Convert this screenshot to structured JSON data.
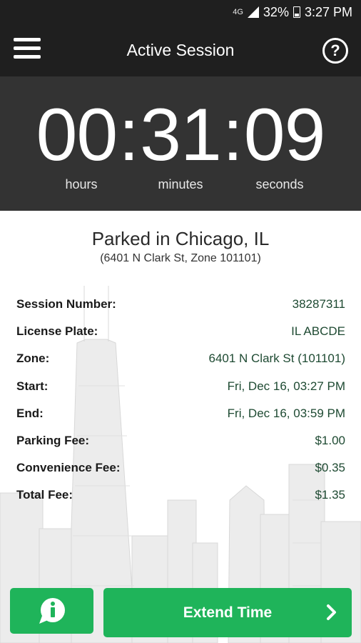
{
  "status_bar": {
    "network": "4G",
    "battery": "32%",
    "time": "3:27 PM"
  },
  "header": {
    "title": "Active Session",
    "menu_icon": "hamburger-menu-icon",
    "help_icon": "help-circle-icon",
    "help_glyph": "?"
  },
  "timer": {
    "hours": "00",
    "minutes": "31",
    "seconds": "09",
    "separator": ":",
    "hours_label": "hours",
    "minutes_label": "minutes",
    "seconds_label": "seconds"
  },
  "location": {
    "title": "Parked in Chicago, IL",
    "subtitle": "(6401 N Clark St, Zone 101101)"
  },
  "details": [
    {
      "label": "Session Number:",
      "value": "38287311"
    },
    {
      "label": "License Plate:",
      "value": "IL ABCDE"
    },
    {
      "label": "Zone:",
      "value": "6401 N Clark St (101101)"
    },
    {
      "label": "Start:",
      "value": "Fri, Dec 16, 03:27 PM"
    },
    {
      "label": "End:",
      "value": "Fri, Dec 16, 03:59 PM"
    },
    {
      "label": "Parking Fee:",
      "value": "$1.00"
    },
    {
      "label": "Convenience Fee:",
      "value": "$0.35"
    },
    {
      "label": "Total Fee:",
      "value": "$1.35"
    }
  ],
  "actions": {
    "info_icon": "info-chat-icon",
    "extend_label": "Extend Time",
    "extend_icon": "chevron-right-icon"
  },
  "colors": {
    "header_bg": "#1f1f1f",
    "timer_bg": "#333333",
    "accent_green": "#1fb45a",
    "value_text": "#1e4a32"
  }
}
